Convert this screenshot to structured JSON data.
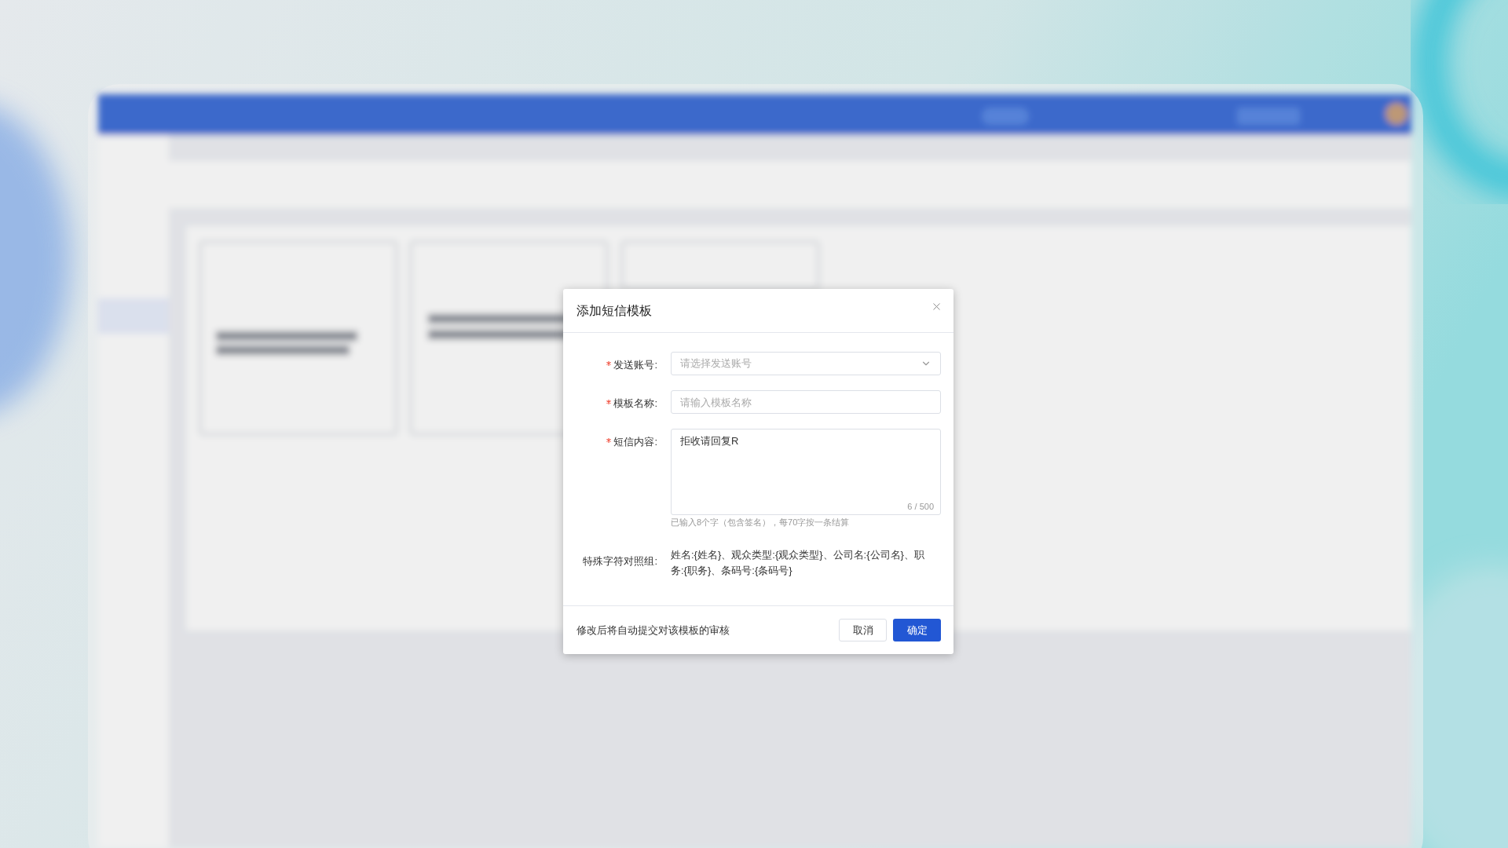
{
  "dialog": {
    "title": "添加短信模板",
    "fields": [
      {
        "kind": "select",
        "label": "发送账号:",
        "required": true,
        "placeholder": "请选择发送账号"
      },
      {
        "kind": "input",
        "label": "模板名称:",
        "required": true,
        "placeholder": "请输入模板名称"
      },
      {
        "kind": "textarea",
        "label": "短信内容:",
        "required": true,
        "value": "拒收请回复R",
        "counter": "6 / 500",
        "hint": "已输入8个字（包含签名），每70字按一条结算"
      }
    ],
    "special": {
      "label": "特殊字符对照组:",
      "value": "姓名:{姓名}、观众类型:{观众类型}、公司名:{公司名}、职务:{职务}、条码号:{条码号}"
    },
    "footer": {
      "note": "修改后将自动提交对该模板的审核",
      "buttons": [
        {
          "label": "取消",
          "primary": false
        },
        {
          "label": "确定",
          "primary": true
        }
      ]
    }
  }
}
